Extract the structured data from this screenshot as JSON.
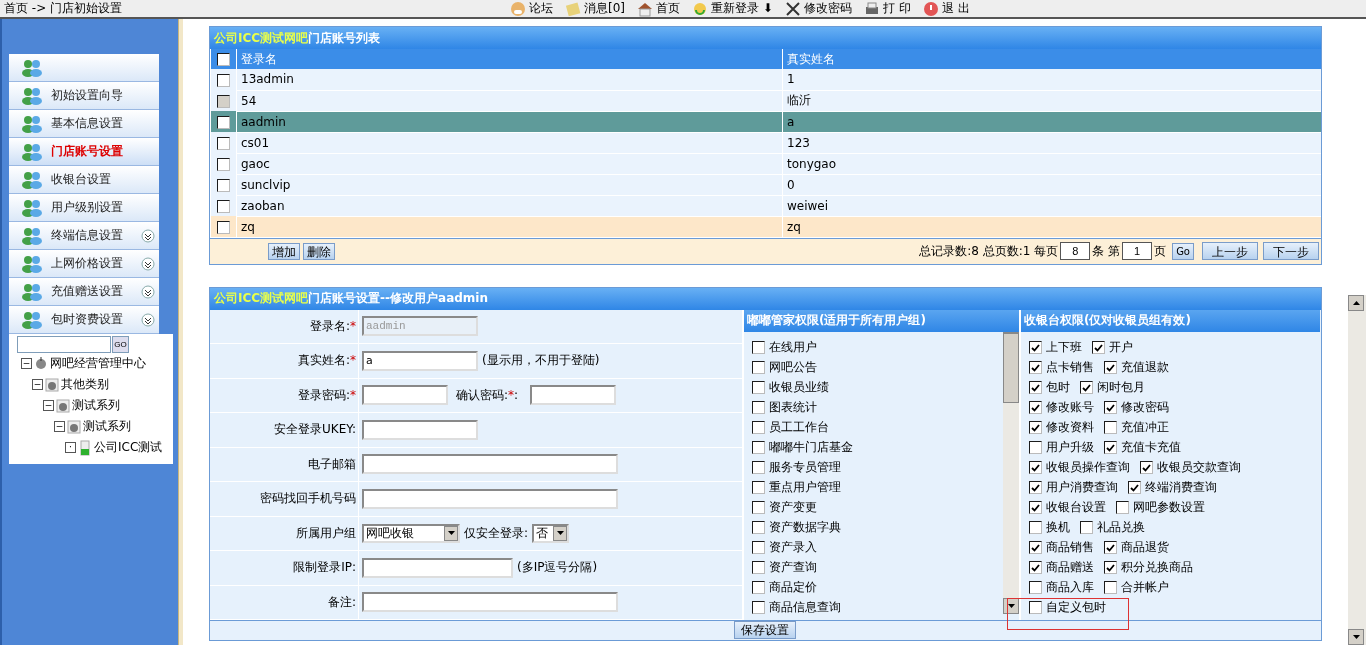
{
  "breadcrumb": {
    "home": "首页",
    "arrow": "->",
    "current": "门店初始设置"
  },
  "toolbar": [
    {
      "label": "论坛"
    },
    {
      "label": "消息[0]"
    },
    {
      "label": "首页"
    },
    {
      "label": "重新登录",
      "suffix": "⬇"
    },
    {
      "label": "修改密码"
    },
    {
      "label": "打 印"
    },
    {
      "label": "退 出"
    }
  ],
  "sidebar": {
    "items": [
      {
        "selected": false,
        "expandable": false
      },
      {
        "label": "初始设置向导",
        "selected": false,
        "expandable": false
      },
      {
        "label": "基本信息设置",
        "selected": false,
        "expandable": false
      },
      {
        "label": "门店账号设置",
        "selected": true,
        "expandable": false
      },
      {
        "label": "收银台设置",
        "selected": false,
        "expandable": false
      },
      {
        "label": "用户级别设置",
        "selected": false,
        "expandable": false
      },
      {
        "label": "终端信息设置",
        "selected": false,
        "expandable": true
      },
      {
        "label": "上网价格设置",
        "selected": false,
        "expandable": true
      },
      {
        "label": "充值赠送设置",
        "selected": false,
        "expandable": true
      },
      {
        "label": "包时资费设置",
        "selected": false,
        "expandable": true
      }
    ],
    "search_button": "GO",
    "tree": [
      {
        "label": "网吧经营管理中心",
        "toggle": "−",
        "children": [
          {
            "label": "其他类别",
            "toggle": "−",
            "children": [
              {
                "label": "测试系列",
                "toggle": "−",
                "children": [
                  {
                    "label": "测试系列",
                    "toggle": "−",
                    "children": [
                      {
                        "label": "公司ICC测试",
                        "toggle": "·"
                      }
                    ]
                  }
                ]
              }
            ]
          }
        ]
      }
    ]
  },
  "accounts_panel": {
    "title_highlight": "公司ICC测试网吧",
    "title": "门店账号列表",
    "select_all_checked": false,
    "columns": [
      "登录名",
      "真实姓名"
    ],
    "rows": [
      {
        "login": "13admin",
        "name": "1",
        "selected": false,
        "hovered": false,
        "disabled": false
      },
      {
        "login": "54",
        "name": "临沂",
        "selected": false,
        "hovered": false,
        "disabled": true
      },
      {
        "login": "aadmin",
        "name": "a",
        "selected": true,
        "hovered": false,
        "disabled": false
      },
      {
        "login": "cs01",
        "name": "123",
        "selected": false,
        "hovered": false,
        "disabled": false
      },
      {
        "login": "gaoc",
        "name": "tonygao",
        "selected": false,
        "hovered": false,
        "disabled": false
      },
      {
        "login": "sunclvip",
        "name": "0",
        "selected": false,
        "hovered": false,
        "disabled": false
      },
      {
        "login": "zaoban",
        "name": "weiwei",
        "selected": false,
        "hovered": false,
        "disabled": false
      },
      {
        "login": "zq",
        "name": "zq",
        "selected": false,
        "hovered": true,
        "disabled": false
      }
    ],
    "buttons": [
      "增加",
      "删除"
    ],
    "pager": {
      "summary": "总记录数:8 总页数:1 每页",
      "per_page": "8",
      "per_page_unit": "条 第",
      "page": "1",
      "page_unit": "页",
      "go": "Go",
      "prev": "上一步",
      "next": "下一步"
    }
  },
  "edit_panel": {
    "title_highlight": "公司ICC测试网吧",
    "title": "门店账号设置--修改用户aadmin",
    "fields": [
      {
        "kind": "short",
        "label": "登录名:",
        "required_mark": "*",
        "value": "aadmin",
        "disabled": true
      },
      {
        "kind": "short",
        "label": "真实姓名:",
        "required_mark": "*",
        "value": "a",
        "note": "(显示用，不用于登陆)"
      },
      {
        "kind": "password",
        "label": "登录密码:",
        "required_mark": "*",
        "confirm_label": "确认密码:",
        "confirm_mark": "*",
        "confirm_colon": ":"
      },
      {
        "kind": "short",
        "label": "安全登录UKEY:"
      },
      {
        "kind": "long",
        "label": "电子邮箱"
      },
      {
        "kind": "wide",
        "label": "密码找回手机号码"
      },
      {
        "kind": "select",
        "label": "所属用户组",
        "value": "网吧收银",
        "extra_label": "仅安全登录:",
        "extra_value": "否"
      },
      {
        "kind": "medium",
        "label": "限制登录IP:",
        "note": "(多IP逗号分隔)"
      },
      {
        "kind": "long",
        "label": "备注:"
      }
    ],
    "manager_perms": {
      "title": "嘟嘟管家权限(适用于所有用户组)",
      "items": [
        {
          "label": "在线用户",
          "checked": false
        },
        {
          "label": "网吧公告",
          "checked": false
        },
        {
          "label": "收银员业绩",
          "checked": false
        },
        {
          "label": "图表统计",
          "checked": false
        },
        {
          "label": "员工工作台",
          "checked": false
        },
        {
          "label": "嘟嘟牛门店基金",
          "checked": false
        },
        {
          "label": "服务专员管理",
          "checked": false
        },
        {
          "label": "重点用户管理",
          "checked": false
        },
        {
          "label": "资产变更",
          "checked": false
        },
        {
          "label": "资产数据字典",
          "checked": false
        },
        {
          "label": "资产录入",
          "checked": false
        },
        {
          "label": "资产查询",
          "checked": false
        },
        {
          "label": "商品定价",
          "checked": false
        },
        {
          "label": "商品信息查询",
          "checked": false
        }
      ]
    },
    "cashier_perms": {
      "title": "收银台权限(仅对收银员组有效)",
      "rows": [
        [
          {
            "label": "上下班",
            "checked": true
          },
          {
            "label": "开户",
            "checked": true
          }
        ],
        [
          {
            "label": "点卡销售",
            "checked": true
          },
          {
            "label": "充值退款",
            "checked": true
          }
        ],
        [
          {
            "label": "包时",
            "checked": true
          },
          {
            "label": "闲时包月",
            "checked": true
          }
        ],
        [
          {
            "label": "修改账号",
            "checked": true
          },
          {
            "label": "修改密码",
            "checked": true
          }
        ],
        [
          {
            "label": "修改资料",
            "checked": true
          },
          {
            "label": "充值冲正",
            "checked": false
          }
        ],
        [
          {
            "label": "用户升级",
            "checked": false
          },
          {
            "label": "充值卡充值",
            "checked": true
          }
        ],
        [
          {
            "label": "收银员操作查询",
            "checked": true
          },
          {
            "label": "收银员交款查询",
            "checked": true
          }
        ],
        [
          {
            "label": "用户消费查询",
            "checked": true
          },
          {
            "label": "终端消费查询",
            "checked": true
          }
        ],
        [
          {
            "label": "收银台设置",
            "checked": true
          },
          {
            "label": "网吧参数设置",
            "checked": false
          }
        ],
        [
          {
            "label": "换机",
            "checked": false
          },
          {
            "label": "礼品兑换",
            "checked": false
          }
        ],
        [
          {
            "label": "商品销售",
            "checked": true
          },
          {
            "label": "商品退货",
            "checked": true
          }
        ],
        [
          {
            "label": "商品赠送",
            "checked": true
          },
          {
            "label": "积分兑换商品",
            "checked": true
          }
        ],
        [
          {
            "label": "商品入库",
            "checked": false
          },
          {
            "label": "合并帐户",
            "checked": false
          }
        ],
        [
          {
            "label": "自定义包时",
            "checked": false,
            "annotated": true
          }
        ]
      ]
    },
    "save_button": "保存设置"
  }
}
